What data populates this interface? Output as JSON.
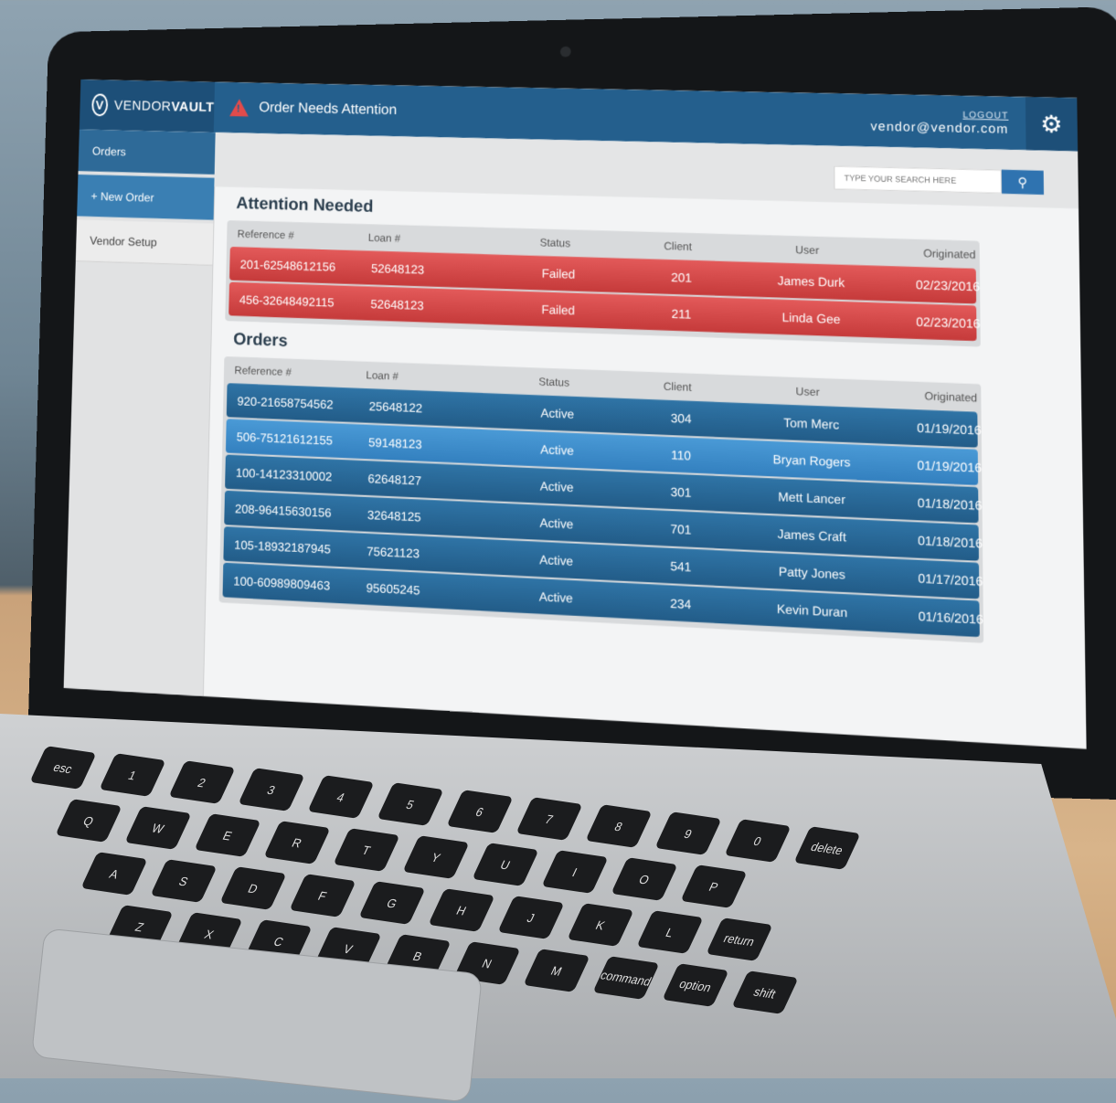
{
  "app": {
    "brand_prefix": "VENDOR",
    "brand_suffix": "VAULT",
    "alert_text": "Order Needs Attention",
    "logout_label": "LOGOUT",
    "user_email": "vendor@vendor.com"
  },
  "sidebar": {
    "items": [
      {
        "label": "Orders"
      },
      {
        "label": "+ New Order"
      },
      {
        "label": "Vendor Setup"
      }
    ]
  },
  "search": {
    "placeholder": "TYPE YOUR SEARCH HERE"
  },
  "attention": {
    "title": "Attention Needed",
    "columns": [
      "Reference #",
      "Loan #",
      "Status",
      "Client",
      "User",
      "Originated"
    ],
    "rows": [
      {
        "ref": "201-62548612156",
        "loan": "52648123",
        "status": "Failed",
        "client": "201",
        "user": "James Durk",
        "originated": "02/23/2016"
      },
      {
        "ref": "456-32648492115",
        "loan": "52648123",
        "status": "Failed",
        "client": "211",
        "user": "Linda Gee",
        "originated": "02/23/2016"
      }
    ]
  },
  "orders": {
    "title": "Orders",
    "columns": [
      "Reference #",
      "Loan #",
      "Status",
      "Client",
      "User",
      "Originated"
    ],
    "rows": [
      {
        "ref": "920-21658754562",
        "loan": "25648122",
        "status": "Active",
        "client": "304",
        "user": "Tom Merc",
        "originated": "01/19/2016"
      },
      {
        "ref": "506-75121612155",
        "loan": "59148123",
        "status": "Active",
        "client": "110",
        "user": "Bryan Rogers",
        "originated": "01/19/2016"
      },
      {
        "ref": "100-14123310002",
        "loan": "62648127",
        "status": "Active",
        "client": "301",
        "user": "Mett Lancer",
        "originated": "01/18/2016"
      },
      {
        "ref": "208-96415630156",
        "loan": "32648125",
        "status": "Active",
        "client": "701",
        "user": "James Craft",
        "originated": "01/18/2016"
      },
      {
        "ref": "105-18932187945",
        "loan": "75621123",
        "status": "Active",
        "client": "541",
        "user": "Patty Jones",
        "originated": "01/17/2016"
      },
      {
        "ref": "100-60989809463",
        "loan": "95605245",
        "status": "Active",
        "client": "234",
        "user": "Kevin Duran",
        "originated": "01/16/2016"
      }
    ]
  },
  "keyboard": {
    "keys": [
      "esc",
      "1",
      "2",
      "3",
      "4",
      "5",
      "6",
      "7",
      "8",
      "9",
      "0",
      "delete",
      "Q",
      "W",
      "E",
      "R",
      "T",
      "Y",
      "U",
      "I",
      "O",
      "P",
      "A",
      "S",
      "D",
      "F",
      "G",
      "H",
      "J",
      "K",
      "L",
      "return",
      "Z",
      "X",
      "C",
      "V",
      "B",
      "N",
      "M",
      "command",
      "option",
      "shift"
    ]
  },
  "colors": {
    "header": "#245f8d",
    "alert_row": "#d94b4b",
    "order_row": "#2a6796",
    "order_row_highlight": "#3d8ccb"
  }
}
